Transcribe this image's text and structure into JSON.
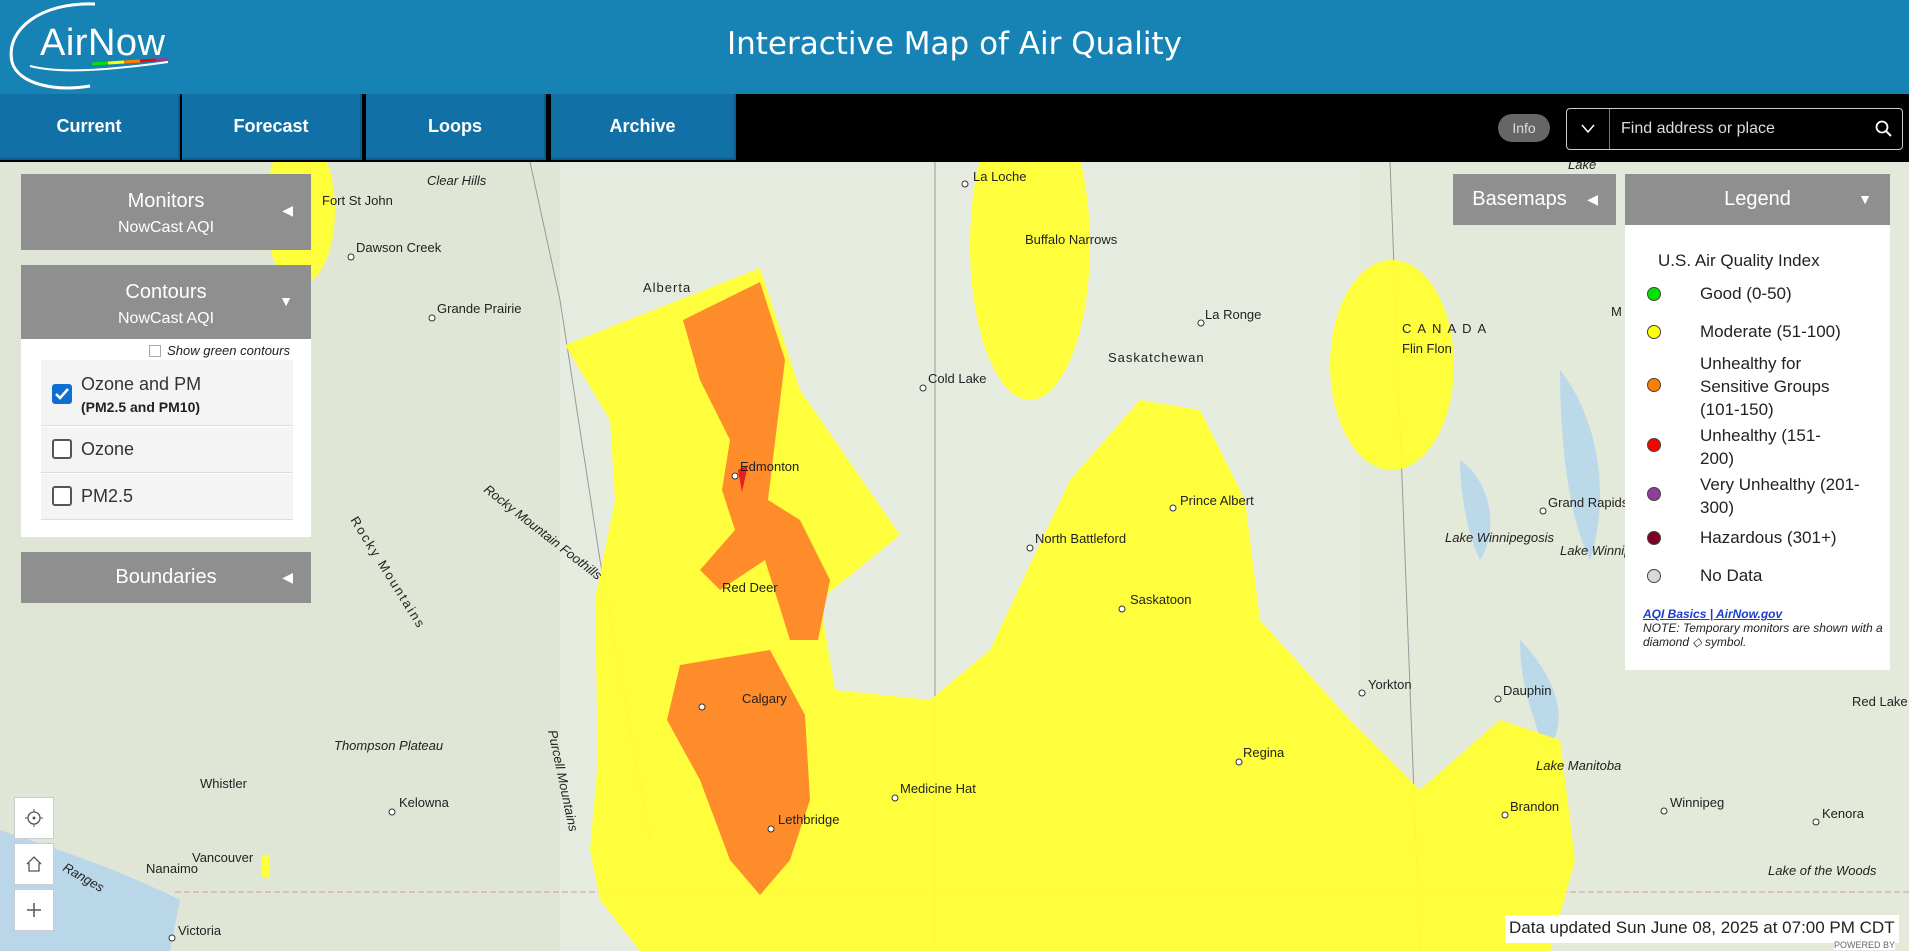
{
  "header": {
    "logo_text": "AirNow",
    "title": "Interactive Map of Air Quality"
  },
  "nav": {
    "tabs": [
      {
        "label": "Current"
      },
      {
        "label": "Forecast"
      },
      {
        "label": "Loops"
      },
      {
        "label": "Archive"
      }
    ],
    "info_label": "Info"
  },
  "search": {
    "placeholder": "Find address or place"
  },
  "panels": {
    "monitors": {
      "title": "Monitors",
      "subtitle": "NowCast AQI"
    },
    "contours": {
      "title": "Contours",
      "subtitle": "NowCast AQI",
      "green_toggle": "Show green contours",
      "options": [
        {
          "label": "Ozone and PM",
          "sub": "(PM2.5 and PM10)",
          "checked": true
        },
        {
          "label": "Ozone",
          "sub": "",
          "checked": false
        },
        {
          "label": "PM2.5",
          "sub": "",
          "checked": false
        }
      ]
    },
    "boundaries": {
      "title": "Boundaries"
    },
    "basemaps": {
      "title": "Basemaps"
    }
  },
  "legend": {
    "title": "Legend",
    "index_title": "U.S. Air Quality Index",
    "items": [
      {
        "label": "Good (0-50)",
        "color": "#00e400"
      },
      {
        "label": "Moderate (51-100)",
        "color": "#ffff00"
      },
      {
        "label": "Unhealthy for Sensitive Groups (101-150)",
        "color": "#ff7e00"
      },
      {
        "label": "Unhealthy (151-200)",
        "color": "#ff0000"
      },
      {
        "label": "Very Unhealthy (201-300)",
        "color": "#8f3f97"
      },
      {
        "label": "Hazardous (301+)",
        "color": "#7e0023"
      },
      {
        "label": "No Data",
        "color": "#d9d9d9"
      }
    ],
    "link": "AQI Basics | AirNow.gov",
    "note": "NOTE: Temporary monitors are shown with a diamond ◇ symbol."
  },
  "map": {
    "places": [
      "Fort St John",
      "Dawson Creek",
      "Clear Hills",
      "Grande Prairie",
      "Alberta",
      "La Loche",
      "Buffalo Narrows",
      "La Ronge",
      "Saskatchewan",
      "CANADA",
      "Flin Flon",
      "Cold Lake",
      "Edmonton",
      "Prince Albert",
      "Rocky Mountain Foothills",
      "Rocky Mountains",
      "North Battleford",
      "Red Deer",
      "Saskatoon",
      "Grand Rapids",
      "Lake Winnipegosis",
      "Lake Winnipeg",
      "Yorkton",
      "Dauphin",
      "Red Lake",
      "Calgary",
      "Regina",
      "Thompson Plateau",
      "Purcell Mountains",
      "Whistler",
      "Medicine Hat",
      "Lake Manitoba",
      "Kelowna",
      "Lethbridge",
      "Brandon",
      "Winnipeg",
      "Kenora",
      "Vancouver",
      "Nanaimo",
      "Victoria",
      "Lake of the Woods",
      "Lake",
      "Ranges",
      "M"
    ],
    "controls": [
      "locate-icon",
      "home-icon",
      "zoom-in-icon"
    ]
  },
  "status": {
    "updated": "Data updated Sun June 08, 2025 at 07:00 PM CDT",
    "powered": "POWERED BY"
  }
}
